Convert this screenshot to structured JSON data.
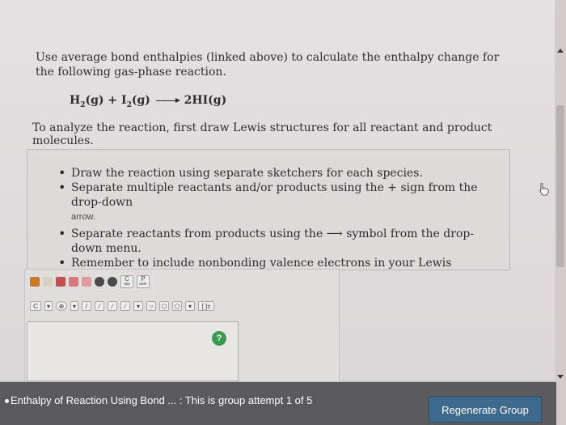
{
  "question": {
    "intro": "Use average bond enthalpies (linked above) to calculate the enthalpy change for the following gas-phase reaction.",
    "equation": {
      "r1": "H",
      "r1_sub": "2",
      "r1_state": "(g)",
      "plus": " + ",
      "r2": "I",
      "r2_sub": "2",
      "r2_state": "(g)",
      "product": "2HI(g)"
    },
    "analyze": "To analyze the reaction, first draw Lewis structures for all reactant and product molecules."
  },
  "hints": [
    {
      "text": "Draw the reaction using separate sketchers for each species.",
      "extra": ""
    },
    {
      "text": "Separate multiple reactants and/or products using the + sign from the drop-down",
      "extra": "arrow."
    },
    {
      "text": "Separate reactants from products using the ⟶ symbol from the drop-down menu.",
      "extra": ""
    },
    {
      "text": "Remember to include nonbonding valence electrons in your Lewis structures.",
      "extra": ""
    }
  ],
  "toolbar": {
    "copy_label": "C",
    "copy_sub": "opy",
    "paste_label": "P",
    "paste_sub": "aste",
    "element_label": "C",
    "bracket_label": "[ ]±"
  },
  "help": "?",
  "footer": {
    "status": "Enthalpy of Reaction Using Bond ... : This is group attempt 1 of 5",
    "regenerate": "Regenerate Group"
  },
  "colors": {
    "footer_bg": "#5a5a5c",
    "button_bg": "#3e6a8e",
    "help_icon": "#3a9a52"
  }
}
